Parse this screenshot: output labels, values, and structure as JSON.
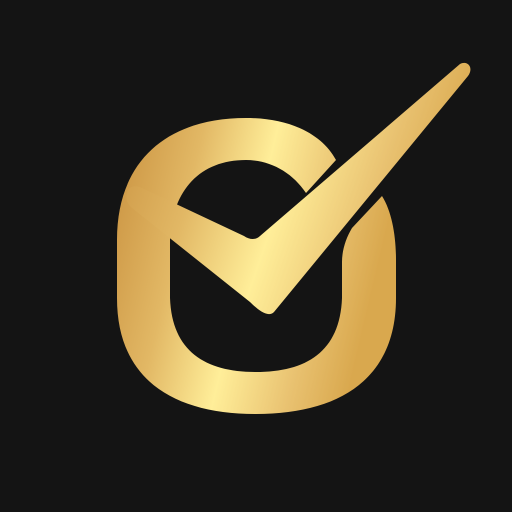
{
  "logo": {
    "name": "gold-o-checkmark-logo",
    "background_color": "#141414",
    "gradient": {
      "colors": [
        "#C9913F",
        "#E2B865",
        "#FFEE99",
        "#E9C271",
        "#D9A84E"
      ]
    }
  }
}
